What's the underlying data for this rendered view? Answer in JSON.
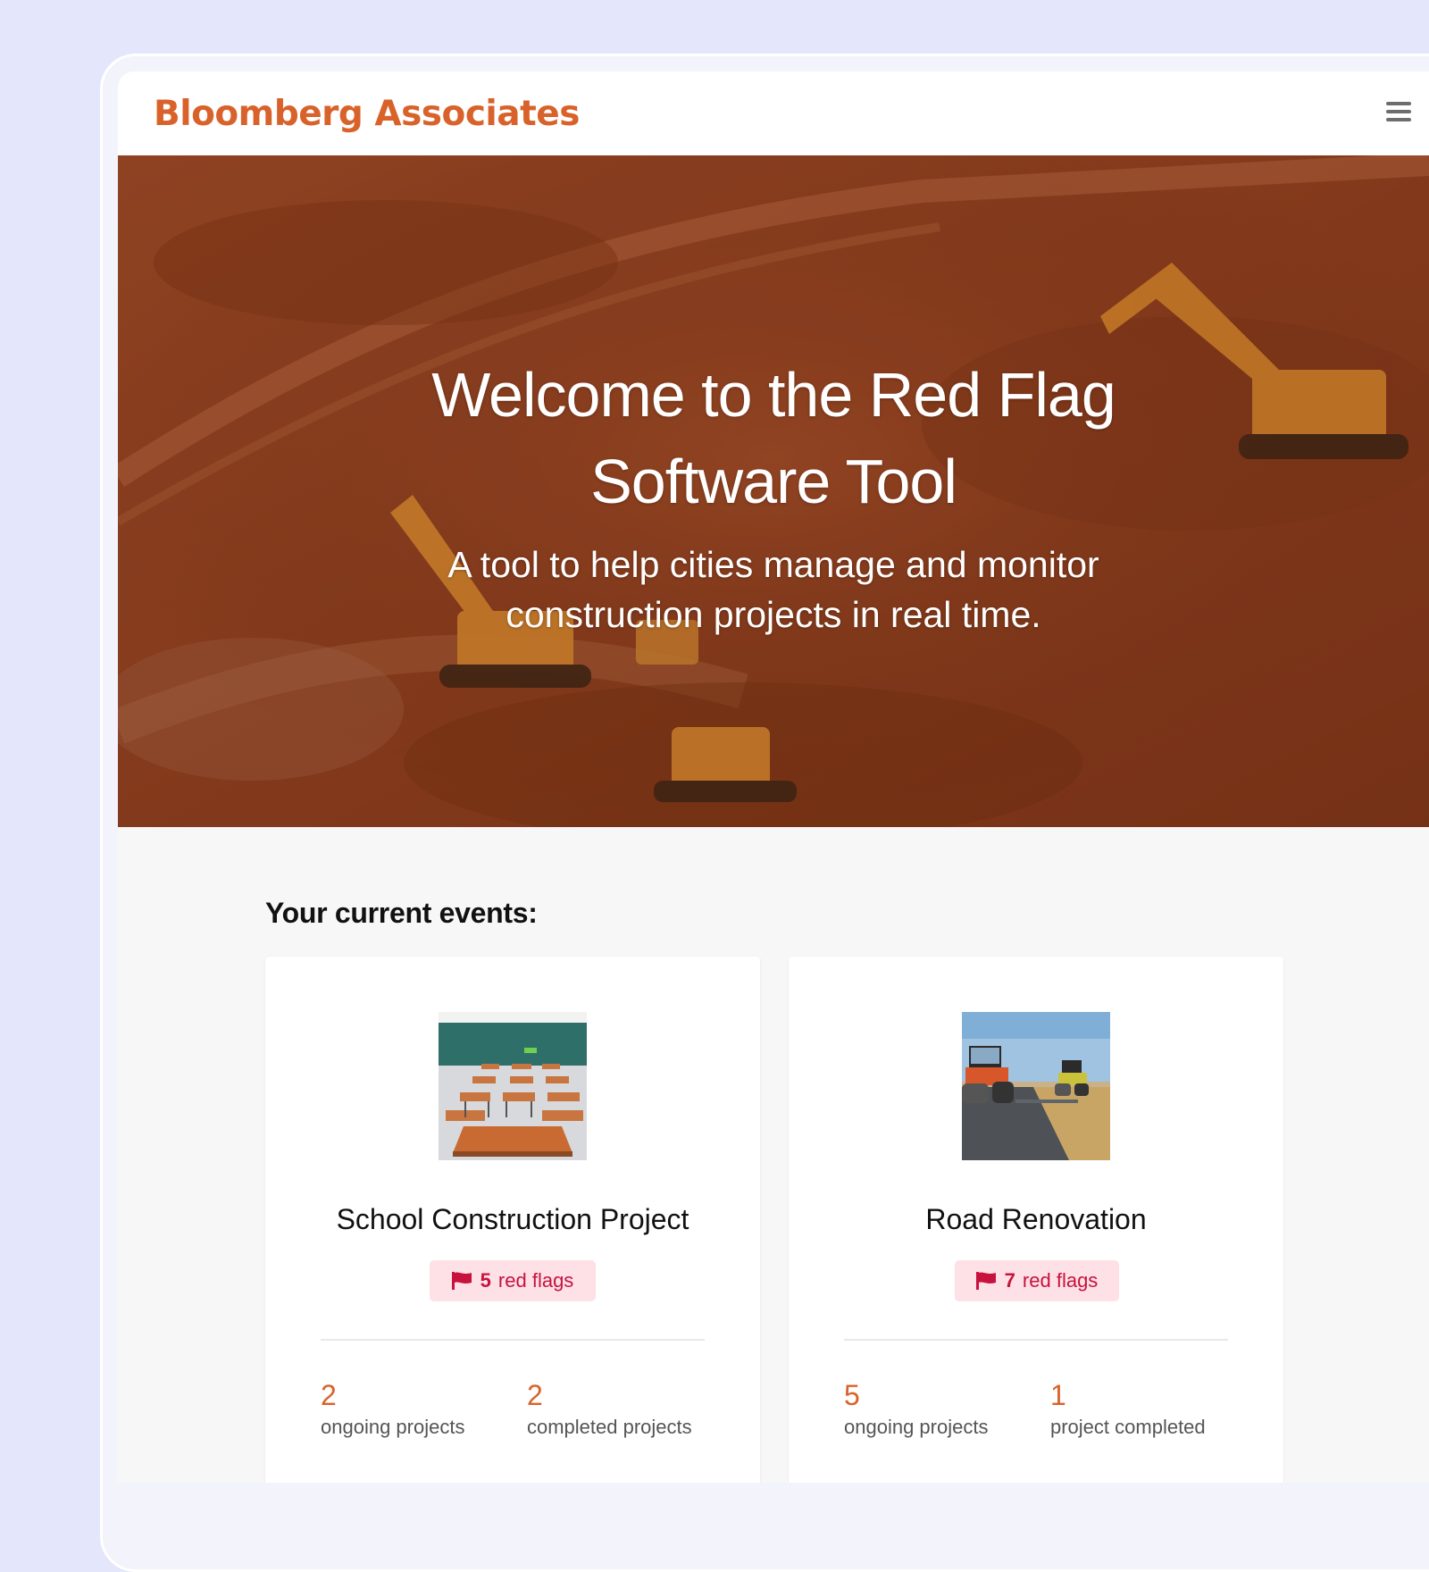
{
  "navbar": {
    "brand": "Bloomberg Associates",
    "menu_icon": "hamburger-menu-icon"
  },
  "hero": {
    "title": "Welcome to the Red Flag Software Tool",
    "subtitle": "A tool to help cities manage and monitor construction projects in real time."
  },
  "events": {
    "heading": "Your current events:",
    "cards": [
      {
        "title": "School Construction Project",
        "red_flags_count": "5",
        "red_flags_label": "red flags",
        "stats": [
          {
            "value": "2",
            "label": "ongoing projects"
          },
          {
            "value": "2",
            "label": "completed projects"
          }
        ]
      },
      {
        "title": "Road Renovation",
        "red_flags_count": "7",
        "red_flags_label": "red flags",
        "stats": [
          {
            "value": "5",
            "label": "ongoing projects"
          },
          {
            "value": "1",
            "label": "project completed"
          }
        ]
      }
    ]
  },
  "colors": {
    "brand": "#d9622b",
    "background": "#e4e7fb",
    "flag_text": "#c8123e",
    "flag_bg": "#fde1e6"
  }
}
